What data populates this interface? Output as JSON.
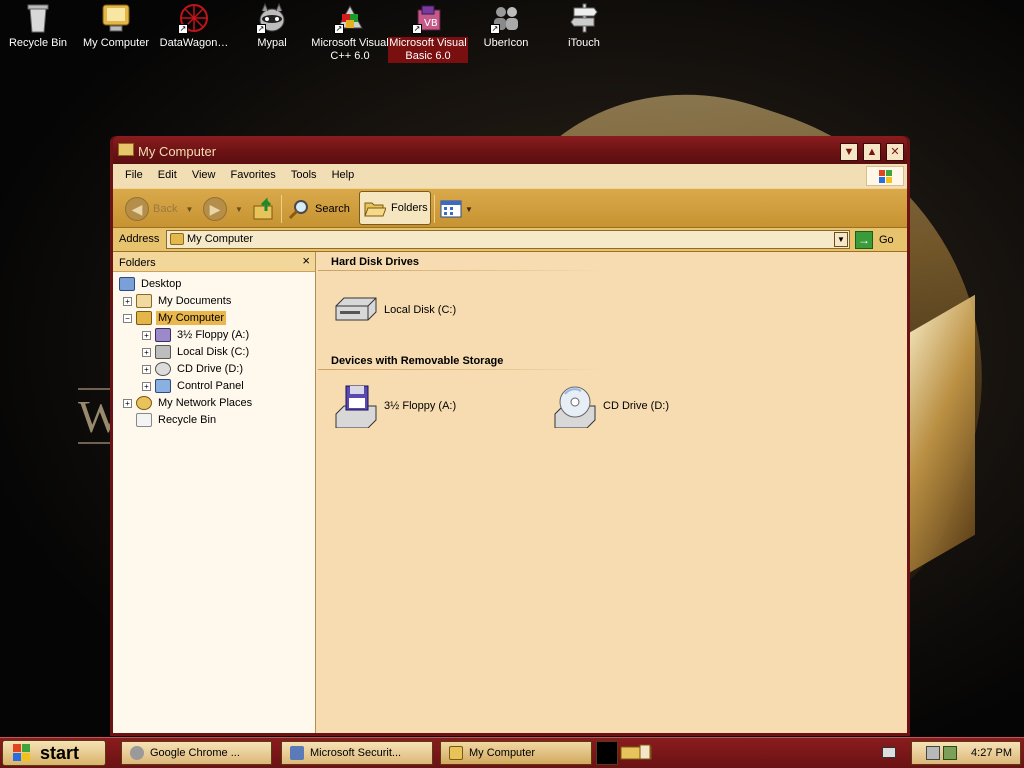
{
  "desktop": {
    "icons": [
      {
        "label": "Recycle Bin",
        "icon": "recycle-bin-icon"
      },
      {
        "label": "My Computer",
        "icon": "my-computer-icon"
      },
      {
        "label": "DataWagon…",
        "icon": "datawagon-icon"
      },
      {
        "label": "Mypal",
        "icon": "mypal-icon"
      },
      {
        "label": "Microsoft Visual C++ 6.0",
        "icon": "visual-cpp-icon"
      },
      {
        "label": "Microsoft Visual Basic 6.0",
        "icon": "visual-basic-icon"
      },
      {
        "label": "UberIcon",
        "icon": "ubericon-icon"
      },
      {
        "label": "iTouch",
        "icon": "itouch-icon"
      }
    ],
    "logo_letter": "W"
  },
  "window": {
    "title": "My Computer",
    "menu": [
      "File",
      "Edit",
      "View",
      "Favorites",
      "Tools",
      "Help"
    ],
    "toolbar": {
      "back": "Back",
      "search": "Search",
      "folders": "Folders"
    },
    "address": {
      "label": "Address",
      "value": "My Computer",
      "go": "Go"
    },
    "folders_pane": {
      "title": "Folders",
      "close": "×",
      "tree": [
        {
          "label": "Desktop"
        },
        {
          "label": "My Documents"
        },
        {
          "label": "My Computer"
        },
        {
          "label": "3½ Floppy (A:)"
        },
        {
          "label": "Local Disk (C:)"
        },
        {
          "label": "CD Drive (D:)"
        },
        {
          "label": "Control Panel"
        },
        {
          "label": "My Network Places"
        },
        {
          "label": "Recycle Bin"
        }
      ]
    },
    "main": {
      "groups": [
        {
          "title": "Hard Disk Drives",
          "items": [
            {
              "label": "Local Disk (C:)"
            }
          ]
        },
        {
          "title": "Devices with Removable Storage",
          "items": [
            {
              "label": "3½ Floppy (A:)"
            },
            {
              "label": "CD Drive (D:)"
            }
          ]
        }
      ]
    }
  },
  "taskbar": {
    "start": "start",
    "tasks": [
      {
        "label": "Google Chrome ..."
      },
      {
        "label": "Microsoft Securit..."
      },
      {
        "label": "My Computer"
      }
    ],
    "clock": "4:27 PM"
  },
  "colors": {
    "title_bar": "#6a1214",
    "toolbar": "#c79332",
    "content_bg": "#f6dcb0",
    "selection": "#e9b74c"
  }
}
